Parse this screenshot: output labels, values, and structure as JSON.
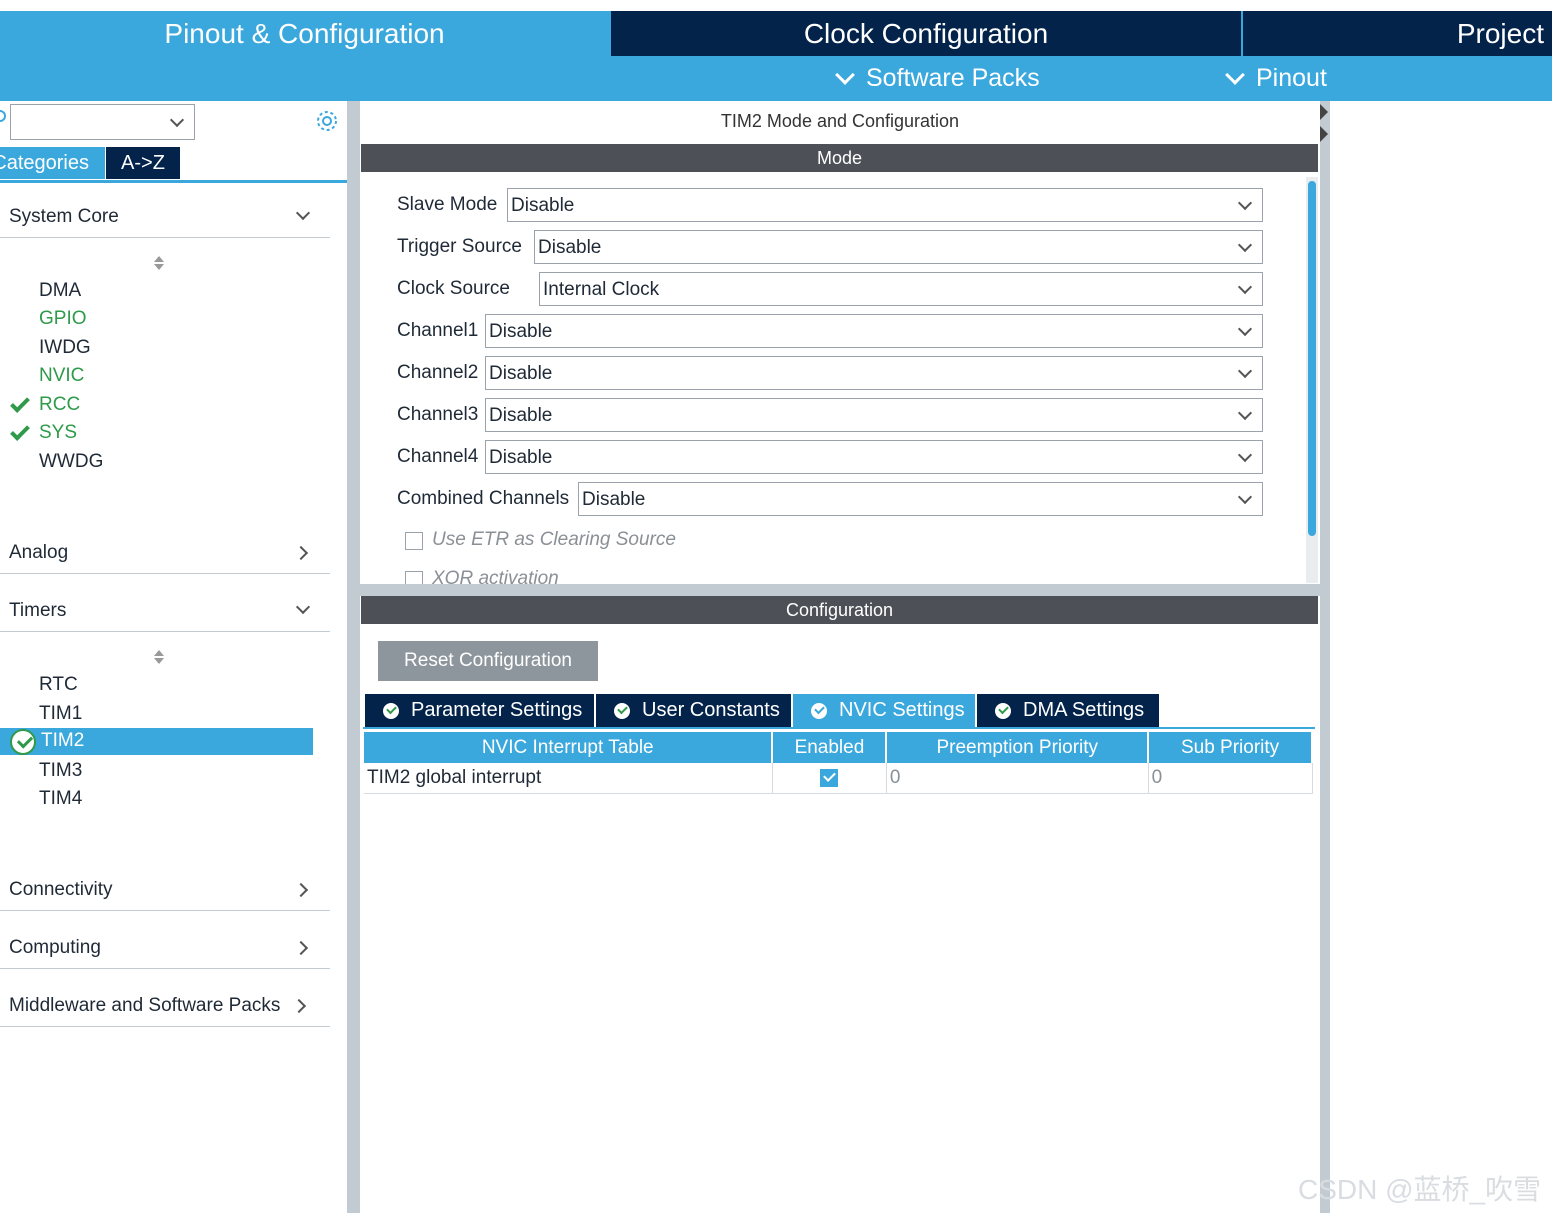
{
  "top_tabs": {
    "pinout": "Pinout & Configuration",
    "clock": "Clock Configuration",
    "project": "Project"
  },
  "sub_menu": {
    "software_packs": "Software Packs",
    "pinout": "Pinout"
  },
  "left": {
    "tab_categories": "Categories",
    "tab_az": "A->Z",
    "groups": {
      "system_core": "System Core",
      "analog": "Analog",
      "timers": "Timers",
      "connectivity": "Connectivity",
      "computing": "Computing",
      "middleware": "Middleware and Software Packs"
    },
    "system_core_items": [
      "DMA",
      "GPIO",
      "IWDG",
      "NVIC",
      "RCC",
      "SYS",
      "WWDG"
    ],
    "timer_items": [
      "RTC",
      "TIM1",
      "TIM2",
      "TIM3",
      "TIM4"
    ]
  },
  "center": {
    "title": "TIM2 Mode and Configuration",
    "mode_header": "Mode",
    "mode_rows": [
      {
        "label": "Slave Mode",
        "value": "Disable"
      },
      {
        "label": "Trigger Source",
        "value": "Disable"
      },
      {
        "label": "Clock Source",
        "value": "Internal Clock"
      },
      {
        "label": "Channel1",
        "value": "Disable"
      },
      {
        "label": "Channel2",
        "value": "Disable"
      },
      {
        "label": "Channel3",
        "value": "Disable"
      },
      {
        "label": "Channel4",
        "value": "Disable"
      },
      {
        "label": "Combined Channels",
        "value": "Disable"
      }
    ],
    "checkboxes": [
      "Use ETR as Clearing Source",
      "XOR activation"
    ],
    "config_header": "Configuration",
    "reset_button": "Reset Configuration",
    "config_tabs": [
      "Parameter Settings",
      "User Constants",
      "NVIC Settings",
      "DMA Settings"
    ],
    "nvic_table": {
      "headers": [
        "NVIC Interrupt Table",
        "Enabled",
        "Preemption Priority",
        "Sub Priority"
      ],
      "rows": [
        {
          "name": "TIM2 global interrupt",
          "enabled": true,
          "preemption": "0",
          "sub": "0"
        }
      ]
    }
  },
  "watermark": "CSDN @蓝桥_吹雪",
  "colors": {
    "accent": "#3ba8dd",
    "navy": "#03234b",
    "green": "#2e9a4a",
    "section_bar": "#4d5157"
  }
}
